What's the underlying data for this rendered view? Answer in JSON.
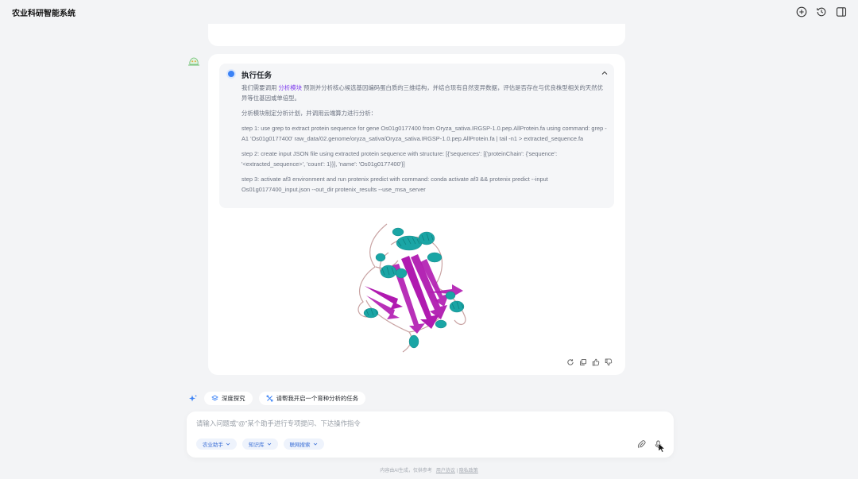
{
  "app": {
    "title": "农业科研智能系统"
  },
  "header": {
    "icons": [
      "new-chat-icon",
      "history-icon",
      "sidebar-toggle-icon"
    ]
  },
  "task": {
    "title": "执行任务",
    "intro_before": "我们需要调用 ",
    "intro_link": "分析模块",
    "intro_after": " 预测并分析核心候选基因编码蛋白质的三维结构，并结合现有自然变异数据，评估是否存在与优良株型相关的天然优异等位基因或单倍型。",
    "plan": "分析模块制定分析计划，并调用云端算力进行分析：",
    "steps": [
      "step 1: use grep to extract protein sequence for gene Os01g0177400 from Oryza_sativa.IRGSP-1.0.pep.AllProtein.fa using command: grep -A1 'Os01g0177400' raw_data/02.genome/oryza_sativa/Oryza_sativa.IRGSP-1.0.pep.AllProtein.fa | tail -n1 > extracted_sequence.fa",
      "step 2: create input JSON file using extracted protein sequence with structure: [{'sequences': [{'proteinChain': {'sequence': '<extracted_sequence>', 'count': 1}}], 'name': 'Os01g0177400'}]",
      "step 3: activate af3 environment and run protenix predict with command: conda activate af3 && protenix predict --input Os01g0177400_input.json --out_dir protenix_results --use_msa_server"
    ]
  },
  "message_actions": [
    "refresh-icon",
    "copy-icon",
    "thumbs-up-icon",
    "thumbs-down-icon"
  ],
  "suggestions": [
    {
      "label": "深度探究",
      "icon": "layers-icon"
    },
    {
      "label": "请帮我开启一个育种分析的任务",
      "icon": "tools-icon"
    }
  ],
  "composer": {
    "placeholder": "请输入问题或“@”某个助手进行专项提问、下达操作指令",
    "tools": [
      {
        "label": "农业助手"
      },
      {
        "label": "知识库"
      },
      {
        "label": "联网搜索"
      }
    ]
  },
  "footer": {
    "notice": "内容由AI生成，仅供参考",
    "links": [
      "用户协议",
      "隐私政策"
    ]
  },
  "colors": {
    "accent": "#3b82f6",
    "link": "#7c3aed",
    "helix": "#1aa5a5",
    "sheet": "#b01ab0",
    "coil": "#c9a3a3"
  }
}
